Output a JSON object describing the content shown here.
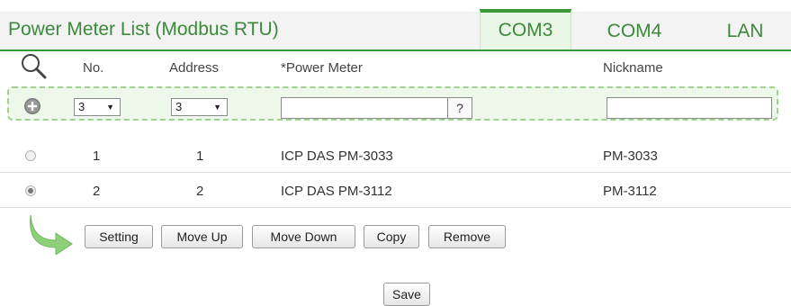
{
  "header": {
    "title": "Power Meter List (Modbus RTU)",
    "tabs": [
      {
        "label": "COM3",
        "active": true
      },
      {
        "label": "COM4",
        "active": false
      },
      {
        "label": "LAN",
        "active": false
      }
    ]
  },
  "columns": {
    "no": "No.",
    "address": "Address",
    "power_meter": "*Power Meter",
    "nickname": "Nickname"
  },
  "add_row": {
    "no_value": "3",
    "address_value": "3",
    "power_meter_value": "",
    "help_label": "?",
    "nickname_value": ""
  },
  "rows": [
    {
      "no": "1",
      "address": "1",
      "power_meter": "ICP DAS PM-3033",
      "nickname": "PM-3033",
      "selected": false
    },
    {
      "no": "2",
      "address": "2",
      "power_meter": "ICP DAS PM-3112",
      "nickname": "PM-3112",
      "selected": true
    }
  ],
  "actions": {
    "setting": "Setting",
    "move_up": "Move Up",
    "move_down": "Move Down",
    "copy": "Copy",
    "remove": "Remove"
  },
  "save_label": "Save",
  "colors": {
    "accent": "#3a9a3a",
    "active_tab_bg": "#eaf6e6",
    "add_row_bg": "#eef8ea"
  }
}
